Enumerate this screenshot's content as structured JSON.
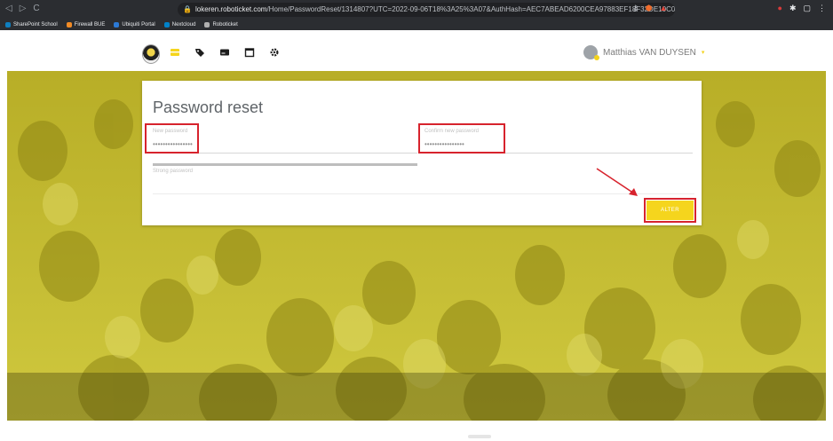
{
  "browser": {
    "url_prefix": "",
    "url_domain": "lokeren.roboticket.com",
    "url_path": "/Home/PasswordReset/1314807?UTC=2022-09-06T18%3A25%3A07&AuthHash=AEC7ABEAD6200CEA97883EF18F32DE10C0C...",
    "bookmarks": [
      {
        "label": "SharePoint School",
        "color": "#0f7fbf"
      },
      {
        "label": "Firewall BUE",
        "color": "#f28b25"
      },
      {
        "label": "Ubiquiti Portal",
        "color": "#2c7ad6"
      },
      {
        "label": "Nextcloud",
        "color": "#0082c9"
      },
      {
        "label": "Roboticket",
        "color": "#b0b0b0"
      }
    ]
  },
  "header": {
    "user_name": "Matthias VAN DUYSEN"
  },
  "form": {
    "title": "Password reset",
    "new_password_label": "New password",
    "new_password_value": "••••••••••••••••",
    "confirm_password_label": "Confirm new password",
    "confirm_password_value": "••••••••••••••••",
    "strength_label": "Strong password",
    "submit_label": "ALTER"
  },
  "colors": {
    "accent": "#f5d51d",
    "highlight": "#d7232d",
    "hero_tint": "#c7bf36"
  }
}
